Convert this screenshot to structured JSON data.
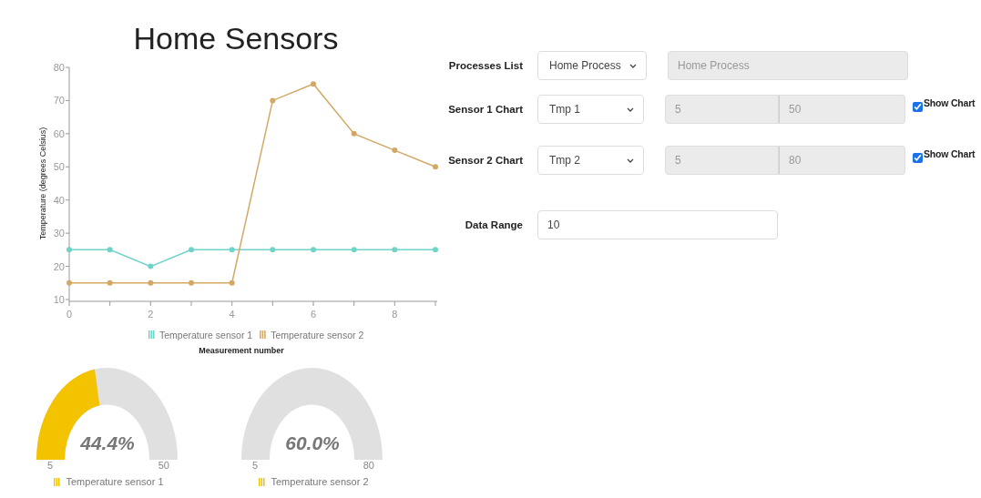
{
  "chart_data": {
    "type": "line",
    "title": "Home Sensors",
    "xlabel": "Measurement number",
    "ylabel": "Temperature (degrees Celsius)",
    "x": [
      0,
      1,
      2,
      3,
      4,
      5,
      6,
      7,
      8,
      9
    ],
    "xlim": [
      0,
      9
    ],
    "ylim": [
      10,
      80
    ],
    "xticks": [
      0,
      2,
      4,
      6,
      8
    ],
    "yticks": [
      10,
      20,
      30,
      40,
      50,
      60,
      70,
      80
    ],
    "legend": true,
    "series": [
      {
        "name": "Temperature sensor 1",
        "color": "#6fd3c8",
        "marker": "circle",
        "values": [
          25,
          25,
          20,
          25,
          25,
          25,
          25,
          25,
          25,
          25
        ]
      },
      {
        "name": "Temperature sensor 2",
        "color": "#d3a865",
        "marker": "circle",
        "values": [
          15,
          15,
          15,
          15,
          15,
          70,
          75,
          60,
          55,
          50
        ]
      }
    ]
  },
  "gauges": [
    {
      "reading": "44.4%",
      "min": "5",
      "max": "50",
      "legend": "Temperature sensor 1",
      "level": 0.444
    },
    {
      "reading": "60.0%",
      "min": "5",
      "max": "80",
      "legend": "Temperature sensor 2"
    }
  ],
  "form": {
    "rows": [
      {
        "kind": "process",
        "label": "Processes List",
        "select": "Home Process",
        "fields": [
          {
            "value": "Home Process",
            "disabled": true
          }
        ]
      },
      {
        "kind": "sensor",
        "label": "Sensor 1 Chart",
        "select": "Tmp 1",
        "fields": [
          {
            "value": "5",
            "disabled": true
          },
          {
            "value": "50",
            "disabled": true
          }
        ],
        "show_chart": {
          "label": "Show Chart",
          "checked": true
        }
      },
      {
        "kind": "sensor",
        "label": "Sensor 2 Chart",
        "select": "Tmp 2",
        "fields": [
          {
            "value": "5",
            "disabled": true
          },
          {
            "value": "80",
            "disabled": true
          }
        ],
        "show_chart": {
          "label": "Show Chart",
          "checked": true
        }
      },
      {
        "kind": "range",
        "label": "Data Range",
        "fields": [
          {
            "value": "10",
            "disabled": false
          }
        ]
      }
    ]
  }
}
